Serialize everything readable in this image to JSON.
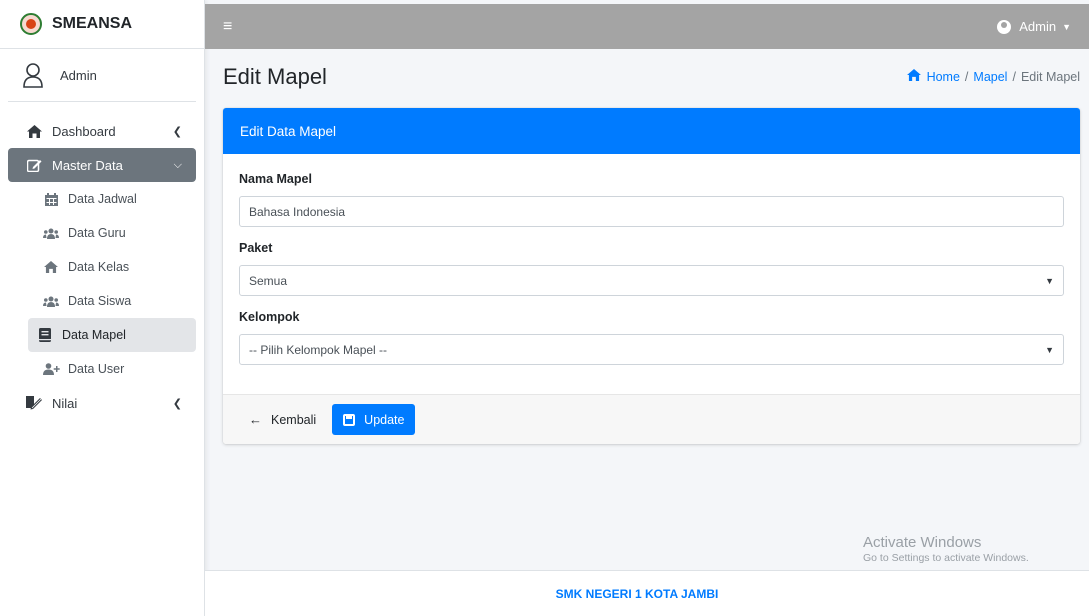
{
  "brand": {
    "name": "SMEANSA"
  },
  "user_panel": {
    "name": "Admin"
  },
  "sidebar": {
    "items": [
      {
        "label": "Dashboard",
        "icon": "home-icon"
      },
      {
        "label": "Master Data",
        "icon": "edit-icon",
        "active": true
      },
      {
        "label": "Data Jadwal",
        "icon": "calendar-icon"
      },
      {
        "label": "Data Guru",
        "icon": "users-icon"
      },
      {
        "label": "Data Kelas",
        "icon": "home-icon"
      },
      {
        "label": "Data Siswa",
        "icon": "users-icon"
      },
      {
        "label": "Data Mapel",
        "icon": "book-icon",
        "current": true
      },
      {
        "label": "Data User",
        "icon": "user-plus-icon"
      },
      {
        "label": "Nilai",
        "icon": "signature-icon"
      }
    ]
  },
  "navbar": {
    "user_label": "Admin"
  },
  "header": {
    "title": "Edit Mapel",
    "breadcrumb": {
      "home": "Home",
      "mapel": "Mapel",
      "current": "Edit Mapel"
    }
  },
  "card": {
    "title": "Edit Data Mapel",
    "fields": {
      "nama": {
        "label": "Nama Mapel",
        "value": "Bahasa Indonesia"
      },
      "paket": {
        "label": "Paket",
        "value": "Semua"
      },
      "kelompok": {
        "label": "Kelompok",
        "value": "-- Pilih Kelompok Mapel --"
      }
    },
    "back_label": "Kembali",
    "update_label": "Update"
  },
  "watermark": {
    "title": "Activate Windows",
    "subtitle": "Go to Settings to activate Windows."
  },
  "footer": {
    "text": "SMK NEGERI 1 KOTA JAMBI"
  },
  "colors": {
    "primary": "#007bff",
    "navbar": "#a4a4a4",
    "active_menu": "#6c757d"
  }
}
